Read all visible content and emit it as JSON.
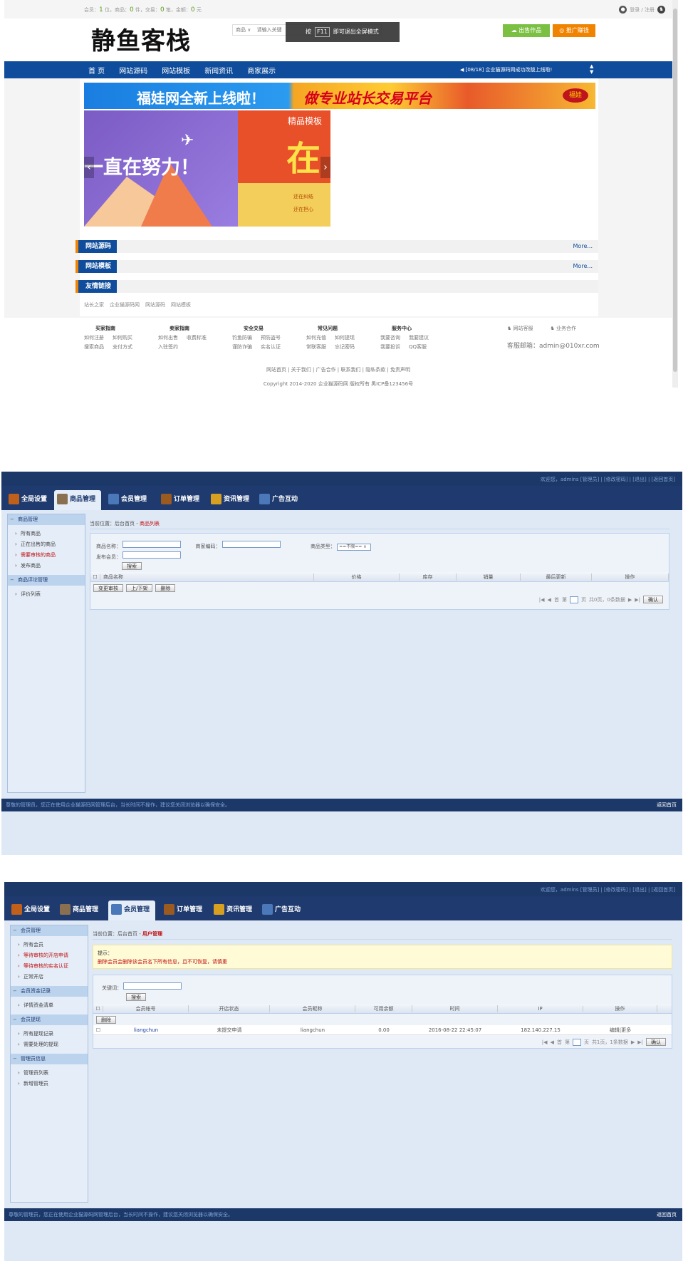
{
  "store": {
    "topbar": {
      "stats": [
        {
          "label": "会员：",
          "value": "1",
          "unit": " 位，"
        },
        {
          "label": "商品：",
          "value": "0",
          "unit": " 件，"
        },
        {
          "label": "交易：",
          "value": "0",
          "unit": " 笔，"
        },
        {
          "label": "金额：",
          "value": "0",
          "unit": " 元"
        }
      ],
      "login": "登录 / 注册"
    },
    "logo": "静鱼客栈",
    "search": {
      "category": "商品 ∨",
      "placeholder": "请输入关键"
    },
    "f11_tip": {
      "pre": "按",
      "key": "F11",
      "post": "即可退出全屏模式"
    },
    "btn_sell": "出售作品",
    "btn_promo": "推广赚钱",
    "nav": [
      "首 页",
      "网站源码",
      "网站模板",
      "新闻资讯",
      "商家展示"
    ],
    "notice": "[08/18] 企业猫源码网成功改版上线啦!",
    "banner": {
      "t1": "福娃网全新上线啦！",
      "t2": "做专业站长交易平台",
      "badge": "福娃"
    },
    "slide1_text": "一直在努力！",
    "slide2": {
      "top": "精品模板",
      "big": "在",
      "l1": "还在纠结",
      "l2": "还在担心"
    },
    "sections": [
      {
        "title": "网站源码",
        "more": "More..."
      },
      {
        "title": "网站模板",
        "more": "More..."
      },
      {
        "title": "友情链接"
      }
    ],
    "friend_links": [
      "站长之家",
      "企业猫源码网",
      "网站源码",
      "网站模板"
    ],
    "footer_cols": [
      {
        "title": "买家指南",
        "rows": [
          [
            "如何注册",
            "如何购买"
          ],
          [
            "搜索商品",
            "支付方式"
          ]
        ]
      },
      {
        "title": "卖家指南",
        "rows": [
          [
            "如何出售",
            "收费标准"
          ],
          [
            "入驻签约"
          ]
        ]
      },
      {
        "title": "安全交易",
        "rows": [
          [
            "钓鱼防骗",
            "预防盗号"
          ],
          [
            "谨防诈骗",
            "实名认证"
          ]
        ]
      },
      {
        "title": "常见问题",
        "rows": [
          [
            "如何充值",
            "如何提现"
          ],
          [
            "常联客服",
            "忘记密码"
          ]
        ]
      },
      {
        "title": "服务中心",
        "rows": [
          [
            "我要咨询",
            "我要建议"
          ],
          [
            "我要投诉",
            "QQ客服"
          ]
        ]
      }
    ],
    "contact": {
      "site_help": "网站客服",
      "biz": "业务合作",
      "email": "客服邮箱：admin@010xr.com"
    },
    "footer_links": "网站首页 | 关于我们 | 广告合作 | 联系我们 | 隐私条款 | 免责声明",
    "copyright": "Copyright 2014-2020 企业猫源码网 版权所有 黑ICP备123456号"
  },
  "admin_top": {
    "links": "欢迎您，admins [管理员] | [修改密码] | [退出] | [返回首页]"
  },
  "admin_tabs": [
    "全局设置",
    "商品管理",
    "会员管理",
    "订单管理",
    "资讯管理",
    "广告互动"
  ],
  "colors": {
    "nav_blue": "#0f4c9b",
    "admin_dark": "#1c3868",
    "accent_red": "#c01010"
  },
  "goods_panel": {
    "side": [
      {
        "group": "商品管理",
        "items": [
          {
            "label": "所有商品",
            "red": false
          },
          {
            "label": "正在出售的商品",
            "red": false
          },
          {
            "label": "需要审核的商品",
            "red": true
          },
          {
            "label": "发布商品",
            "red": false
          }
        ]
      },
      {
        "group": "商品评论管理",
        "items": [
          {
            "label": "评价列表",
            "red": false
          }
        ]
      }
    ],
    "crumb_pre": "当前位置：后台首页 - ",
    "crumb_cur": "商品列表",
    "form": {
      "name": "商品名称：",
      "seller": "商家编码：",
      "status": "商品类型：",
      "status_value": "==不限== ∨",
      "publisher": "发布会员：",
      "search": "搜索"
    },
    "columns": [
      "商品名称",
      "价格",
      "库存",
      "销量",
      "最后更新",
      "操作"
    ],
    "buttons": [
      "变更审核",
      "上/下架",
      "删除"
    ],
    "pager": {
      "first": "首",
      "page_pre": "第",
      "page_post": "页",
      "total": "共0页，0条数据",
      "ok": "确认"
    }
  },
  "member_panel": {
    "side": [
      {
        "group": "会员管理",
        "items": [
          {
            "label": "所有会员",
            "red": false
          },
          {
            "label": "等待审核的开店申请",
            "red": true
          },
          {
            "label": "等待审核的实名认证",
            "red": true
          },
          {
            "label": "正常开店",
            "red": false
          }
        ]
      },
      {
        "group": "会员资金记录",
        "items": [
          {
            "label": "详情资金清单",
            "red": false
          }
        ]
      },
      {
        "group": "会员提现",
        "items": [
          {
            "label": "所有提现记录",
            "red": false
          },
          {
            "label": "需要处理的提现",
            "red": false
          }
        ]
      },
      {
        "group": "管理员信息",
        "items": [
          {
            "label": "管理员列表",
            "red": false
          },
          {
            "label": "新增管理员",
            "red": false
          }
        ]
      }
    ],
    "crumb_pre": "当前位置：后台首页 - ",
    "crumb_cur": "用户管理",
    "tip_title": "提示：",
    "tip_text": "删除会员会删除该会员名下所有信息，且不可恢复，请慎重",
    "keyword": "关键词：",
    "search": "搜索",
    "columns": [
      "会员帐号",
      "开店状态",
      "会员昵称",
      "可用余额",
      "时间",
      "IP",
      "操作"
    ],
    "delete_btn": "删除",
    "row": {
      "account": "liangchun",
      "status": "未提交申请",
      "nick": "liangchun",
      "balance": "0.00",
      "time": "2016-08-22 22:45:07",
      "ip": "182.140.227.15",
      "op": "编辑|更多"
    },
    "pager": {
      "first": "首",
      "page_pre": "第",
      "page_post": "页",
      "total": "共1页，1条数据",
      "ok": "确认"
    }
  },
  "bottom_strip": {
    "left": "尊敬的管理员，您正在使用企业猫源码网管理后台，当长时间不操作，建议您关闭浏览器以确保安全。",
    "right": "返回首页"
  }
}
